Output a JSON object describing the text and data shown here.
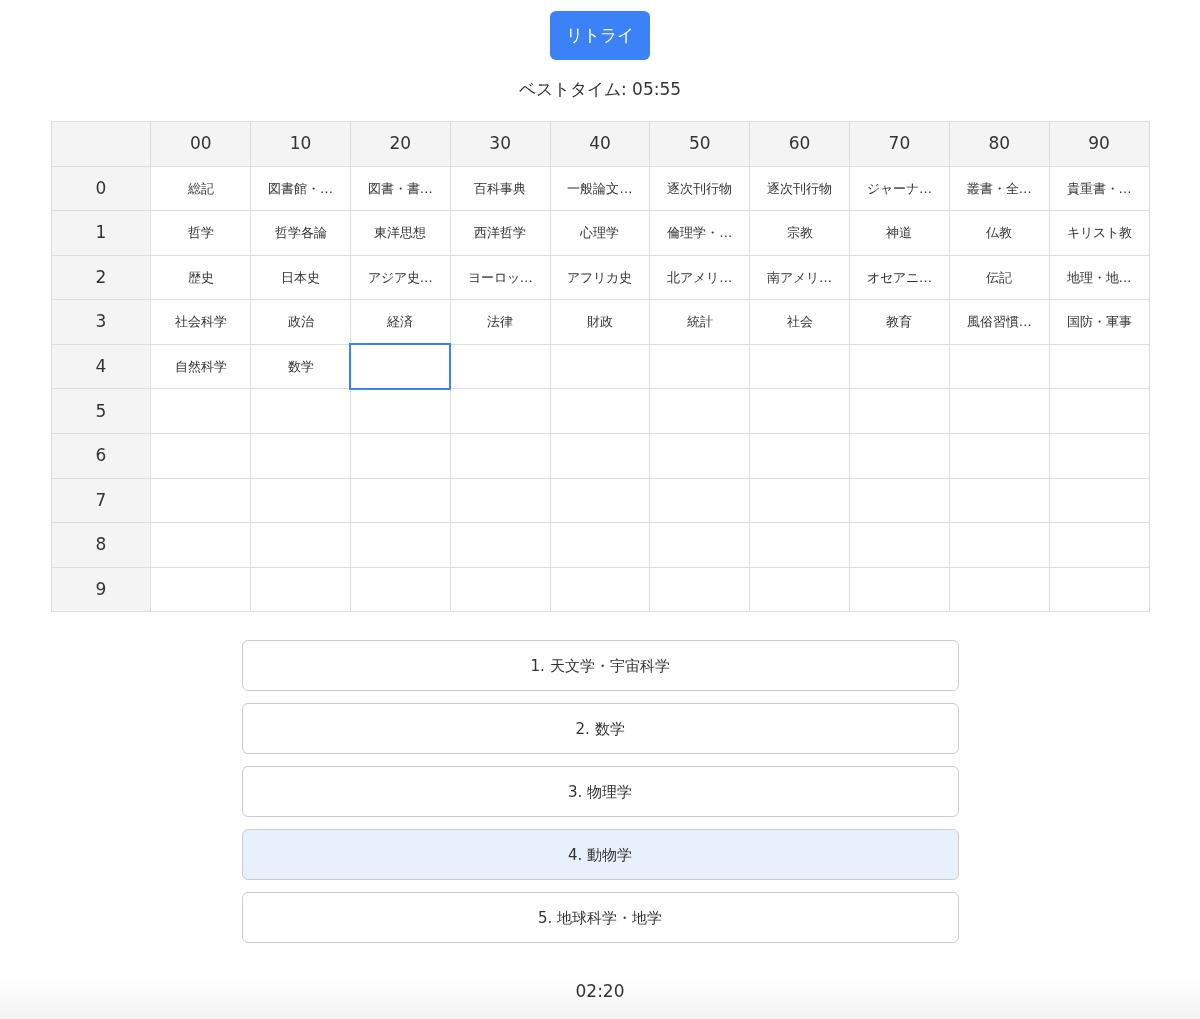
{
  "retry_button": "リトライ",
  "best_time": "ベストタイム: 05:55",
  "table": {
    "columns": [
      "00",
      "10",
      "20",
      "30",
      "40",
      "50",
      "60",
      "70",
      "80",
      "90"
    ],
    "rows": [
      {
        "label": "0",
        "cells": [
          {
            "text": "総記",
            "selected": false
          },
          {
            "text": "図書館・…",
            "selected": false
          },
          {
            "text": "図書・書…",
            "selected": false
          },
          {
            "text": "百科事典",
            "selected": false
          },
          {
            "text": "一般論文…",
            "selected": false
          },
          {
            "text": "逐次刊行物",
            "selected": false
          },
          {
            "text": "逐次刊行物",
            "selected": false
          },
          {
            "text": "ジャーナ…",
            "selected": false
          },
          {
            "text": "叢書・全…",
            "selected": false
          },
          {
            "text": "貴重書・…",
            "selected": false
          }
        ]
      },
      {
        "label": "1",
        "cells": [
          {
            "text": "哲学",
            "selected": false
          },
          {
            "text": "哲学各論",
            "selected": false
          },
          {
            "text": "東洋思想",
            "selected": false
          },
          {
            "text": "西洋哲学",
            "selected": false
          },
          {
            "text": "心理学",
            "selected": false
          },
          {
            "text": "倫理学・…",
            "selected": false
          },
          {
            "text": "宗教",
            "selected": false
          },
          {
            "text": "神道",
            "selected": false
          },
          {
            "text": "仏教",
            "selected": false
          },
          {
            "text": "キリスト教",
            "selected": false
          }
        ]
      },
      {
        "label": "2",
        "cells": [
          {
            "text": "歴史",
            "selected": false
          },
          {
            "text": "日本史",
            "selected": false
          },
          {
            "text": "アジア史…",
            "selected": false
          },
          {
            "text": "ヨーロッ…",
            "selected": false
          },
          {
            "text": "アフリカ史",
            "selected": false
          },
          {
            "text": "北アメリ…",
            "selected": false
          },
          {
            "text": "南アメリ…",
            "selected": false
          },
          {
            "text": "オセアニ…",
            "selected": false
          },
          {
            "text": "伝記",
            "selected": false
          },
          {
            "text": "地理・地…",
            "selected": false
          }
        ]
      },
      {
        "label": "3",
        "cells": [
          {
            "text": "社会科学",
            "selected": false
          },
          {
            "text": "政治",
            "selected": false
          },
          {
            "text": "経済",
            "selected": false
          },
          {
            "text": "法律",
            "selected": false
          },
          {
            "text": "財政",
            "selected": false
          },
          {
            "text": "統計",
            "selected": false
          },
          {
            "text": "社会",
            "selected": false
          },
          {
            "text": "教育",
            "selected": false
          },
          {
            "text": "風俗習慣…",
            "selected": false
          },
          {
            "text": "国防・軍事",
            "selected": false
          }
        ]
      },
      {
        "label": "4",
        "cells": [
          {
            "text": "自然科学",
            "selected": false
          },
          {
            "text": "数学",
            "selected": false
          },
          {
            "selected": true
          }
        ]
      },
      {
        "label": "5",
        "cells": []
      },
      {
        "label": "6",
        "cells": []
      },
      {
        "label": "7",
        "cells": []
      },
      {
        "label": "8",
        "cells": []
      },
      {
        "label": "9",
        "cells": []
      }
    ]
  },
  "options": [
    {
      "label": "1. 天文学・宇宙科学",
      "selected": false
    },
    {
      "label": "2. 数学",
      "selected": false
    },
    {
      "label": "3. 物理学",
      "selected": false
    },
    {
      "label": "4. 動物学",
      "selected": true
    },
    {
      "label": "5. 地球科学・地学",
      "selected": false
    }
  ],
  "timer": "02:20"
}
